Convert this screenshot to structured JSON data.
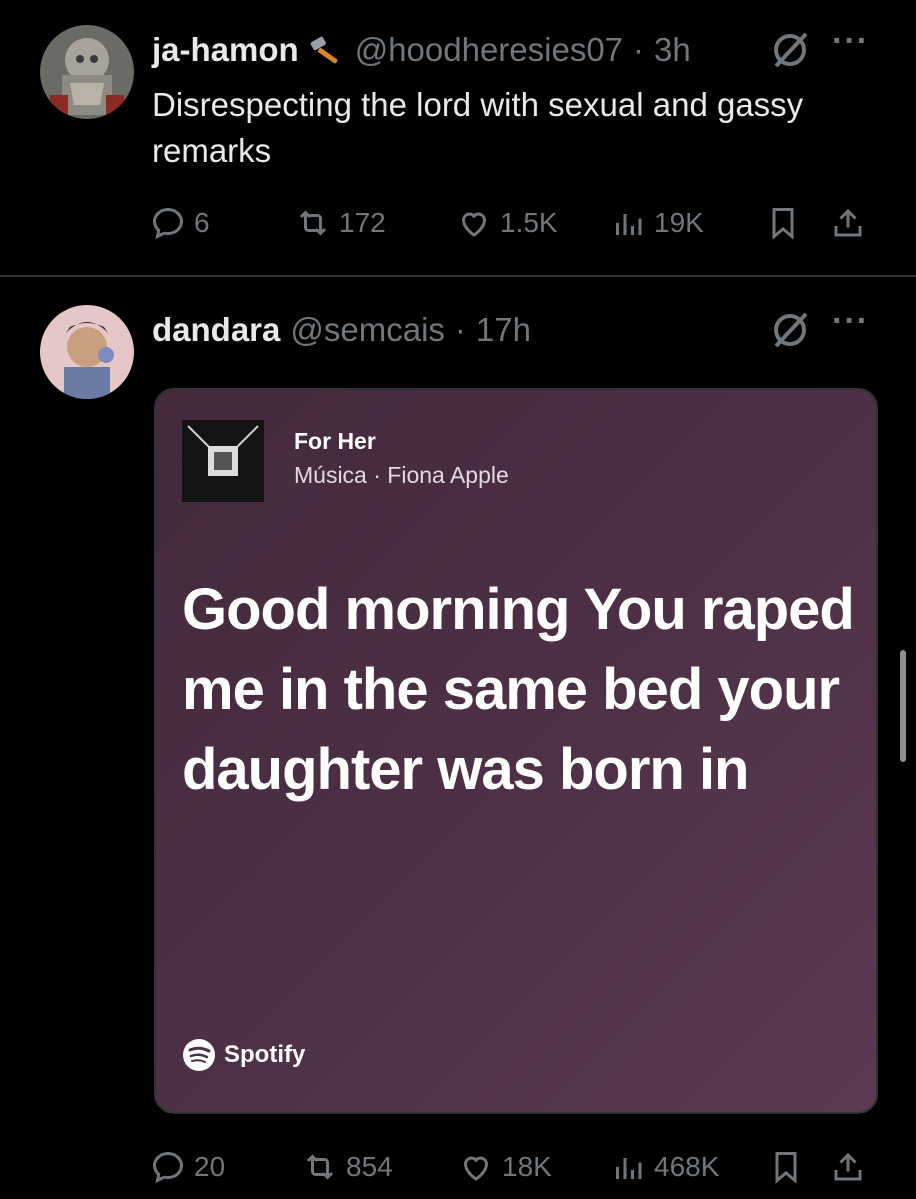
{
  "tweets": [
    {
      "name": "ja-hamon",
      "handle": "@hoodheresies07",
      "dot": "·",
      "time": "3h",
      "text": "Disrespecting the lord with sexual and gassy remarks",
      "replies": "6",
      "reposts": "172",
      "likes": "1.5K",
      "views": "19K",
      "name_emoji_icon": "hammer-icon",
      "avatar_icon": "armored-figure-avatar"
    },
    {
      "name": "dandara",
      "handle": "@semcais",
      "dot": "·",
      "time": "17h",
      "replies": "20",
      "reposts": "854",
      "likes": "18K",
      "views": "468K",
      "avatar_icon": "person-avatar",
      "card": {
        "song_title": "For Her",
        "song_meta": "Música · Fiona Apple",
        "lyrics": "Good morning You raped me in the same bed your daughter was born in",
        "brand": "Spotify",
        "background": "#4c2f45"
      }
    }
  ],
  "colors": {
    "background": "#000000",
    "muted": "#71767b",
    "text": "#e7e9ea",
    "divider": "#2f3336"
  }
}
